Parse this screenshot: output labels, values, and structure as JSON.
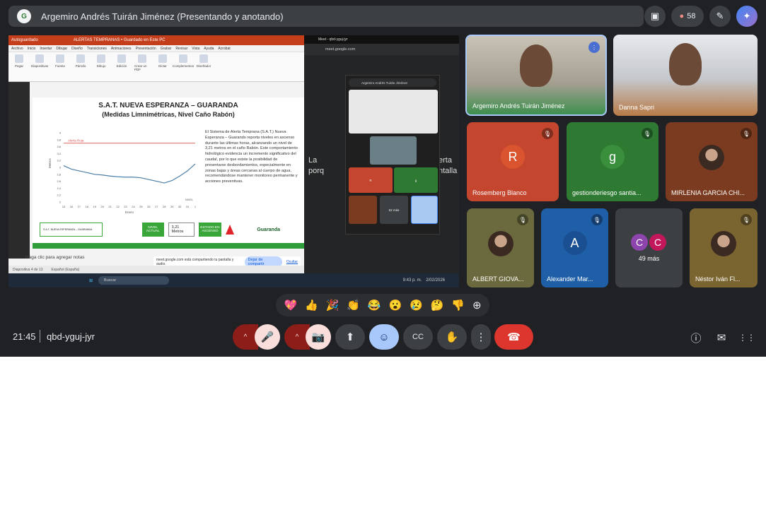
{
  "meeting": {
    "presenter_title": "Argemiro Andrés Tuirán Jiménez (Presentando y anotando)",
    "presenter_logo": "Guaranda",
    "participant_count": "58",
    "time": "21:45",
    "code": "qbd-yguj-jyr"
  },
  "shared_screen": {
    "ppt_window_title": "ALERTAS TEMPRANAS • Guardado en Este PC",
    "autosave_label": "Autoguardado",
    "menu": [
      "Archivo",
      "Inicio",
      "Insertar",
      "Dibujar",
      "Diseño",
      "Transiciones",
      "Animaciones",
      "Presentación",
      "Grabar",
      "Revisar",
      "Vista",
      "Ayuda",
      "Acrobat"
    ],
    "ribbon": [
      "Pegar",
      "Diapositivas",
      "Fuente",
      "Párrafo",
      "Dibujo",
      "Edición",
      "Crear un PDF",
      "Dictar",
      "Complementos",
      "Diseñador"
    ],
    "slide_title": "S.A.T. NUEVA ESPERANZA – GUARANDA",
    "slide_subtitle": "(Medidas Limnimétricas, Nivel Caño Rabón)",
    "slide_body": "El Sistema de Alerta Temprana (S.A.T.) Nueva Esperanza – Guarando reporta niveles en ascenso durante las últimas horas, alcanzando un nivel de 3,21 metros en el caño Rabón. Este comportamiento hidrológico evidencia un incremento significativo del caudal, por lo que existe la posibilidad de presentarse desbordamientos, especialmente en zonas bajas y áreas cercanas al cuerpo de agua, recomendándose mantener monitoreo permanente y acciones preventivas.",
    "alert_label": "Alerta Roja",
    "level_label": "NIVEL ACTUAL",
    "level_value": "3,21 Metros",
    "state_label": "ESTADO EN ASCENSO",
    "month_label": "Enero",
    "notes_placeholder": "Haga clic para agregar notas",
    "status_slide": "Diapositiva 4 de 13",
    "status_lang": "Español (España)",
    "share_msg": "meet.google.com está compartiendo tu pantalla y audio.",
    "stop_share": "Dejar de compartir",
    "hide": "Ocultar",
    "browser_tab": "Meet - qbd-yguj-jyr",
    "browser_url": "meet.google.com",
    "inner_presenter": "Argemiro Andrés Tuirán Jiménez",
    "inner_more": "52 más",
    "taskbar_search": "Buscar",
    "taskbar_time": "9:43 p. m.",
    "taskbar_date": "2/02/2026",
    "browser_text_left": "La",
    "browser_text_left2": "porq",
    "browser_text_right": "erta",
    "browser_text_right2": "ntalla"
  },
  "chart_data": {
    "type": "line",
    "x": [
      15,
      16,
      17,
      18,
      19,
      20,
      21,
      22,
      23,
      24,
      25,
      26,
      27,
      28,
      29,
      30,
      31,
      1
    ],
    "series": [
      {
        "name": "NIVEL",
        "values": [
          3.05,
          2.95,
          2.9,
          2.85,
          2.8,
          2.78,
          2.75,
          2.73,
          2.72,
          2.72,
          2.7,
          2.65,
          2.6,
          2.55,
          2.62,
          2.75,
          2.9,
          3.1
        ]
      }
    ],
    "alert_line": 3.7,
    "ylim": [
      2.0,
      4.0
    ],
    "yticks": [
      "4",
      "3,8",
      "3,6",
      "3,4",
      "3,2",
      "3",
      "2,8",
      "2,6",
      "2,4",
      "2,2",
      "2"
    ],
    "ylabel": "Metros",
    "xlabel": "Enero",
    "colors": {
      "series": "#4b7fa8",
      "alert": "#d9534f"
    }
  },
  "tiles": [
    {
      "name": "Argemiro Andrés Tuirán Jiménez",
      "kind": "video",
      "speaking": true
    },
    {
      "name": "Danna Sapri",
      "kind": "video"
    },
    {
      "name": "Rosemberg Blanco",
      "letter": "R",
      "bg": "#c4462f",
      "avatar": "#d9542f"
    },
    {
      "name": "gestionderiesgo santia...",
      "letter": "g",
      "bg": "#2f7a32",
      "avatar": "#3a8f3d"
    },
    {
      "name": "MIRLENIA GARCIA CHI...",
      "kind": "photo",
      "bg": "#7a3b20"
    },
    {
      "name": "ALBERT GIOVA...",
      "kind": "photo",
      "bg": "#6b6a3e"
    },
    {
      "name": "Alexander Mar...",
      "letter": "A",
      "bg": "#1f5fa8",
      "avatar": "#1a4f91"
    },
    {
      "name": "49 más",
      "kind": "more",
      "bg": "#3c4043"
    },
    {
      "name": "Néstor Iván Fl...",
      "kind": "photo",
      "bg": "#7a6430"
    }
  ],
  "reactions": [
    "💖",
    "👍",
    "🎉",
    "👏",
    "😂",
    "😮",
    "😢",
    "🤔",
    "👎",
    "⊕"
  ],
  "controls": {
    "mic": "🎤",
    "camera": "📷",
    "present": "⬆",
    "emoji": "☺",
    "captions": "CC",
    "hand": "✋",
    "more": "⋮",
    "hangup": "☎",
    "caret": "^",
    "info": "ⓘ",
    "chat": "✉",
    "activities": "⋮⋮"
  }
}
